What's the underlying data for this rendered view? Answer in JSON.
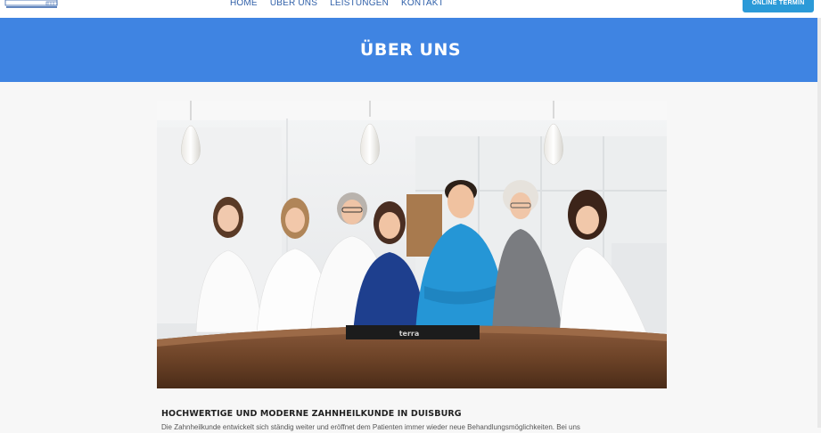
{
  "nav": {
    "items": [
      {
        "label": "HOME"
      },
      {
        "label": "ÜBER UNS"
      },
      {
        "label": "LEISTUNGEN"
      },
      {
        "label": "KONTAKT"
      }
    ],
    "cta_label": "ONLINE TERMIN"
  },
  "hero": {
    "title": "ÜBER UNS"
  },
  "photo": {
    "monitor_brand": "terra"
  },
  "content": {
    "heading": "HOCHWERTIGE UND MODERNE ZAHNHEILKUNDE IN DUISBURG",
    "text": "Die Zahnheilkunde entwickelt sich ständig weiter und eröffnet dem Patienten immer wieder neue Behandlungsmöglichkeiten. Bei uns"
  },
  "colors": {
    "hero_background": "#3f84e2",
    "cta_background": "#2b9ad8",
    "nav_text": "#2f5fa8"
  }
}
